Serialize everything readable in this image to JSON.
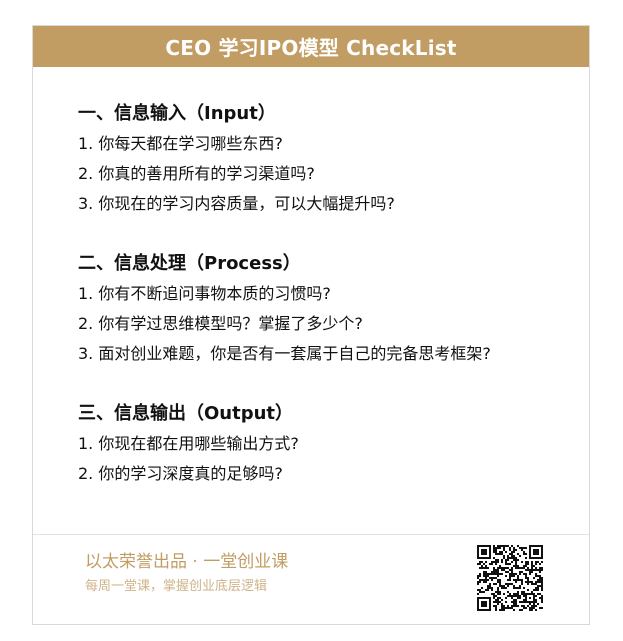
{
  "header": {
    "title": "CEO 学习IPO模型 CheckList"
  },
  "sections": [
    {
      "title": "一、信息输入（Input）",
      "items": [
        "1. 你每天都在学习哪些东西?",
        "2. 你真的善用所有的学习渠道吗?",
        "3. 你现在的学习内容质量，可以大幅提升吗?"
      ]
    },
    {
      "title": "二、信息处理（Process）",
      "items": [
        "1. 你有不断追问事物本质的习惯吗?",
        "2. 你有学过思维模型吗？掌握了多少个?",
        "3. 面对创业难题，你是否有一套属于自己的完备思考框架?"
      ]
    },
    {
      "title": "三、信息输出（Output）",
      "items": [
        "1. 你现在都在用哪些输出方式?",
        "2. 你的学习深度真的足够吗?"
      ]
    }
  ],
  "footer": {
    "brand": "以太荣誉出品 · 一堂创业课",
    "slogan": "每周一堂课，掌握创业底层逻辑",
    "qr_icon": "qr-code-icon"
  },
  "colors": {
    "header_bg": "#c29d63",
    "brand_text": "#c29d63",
    "slogan_text": "#cfb389"
  }
}
